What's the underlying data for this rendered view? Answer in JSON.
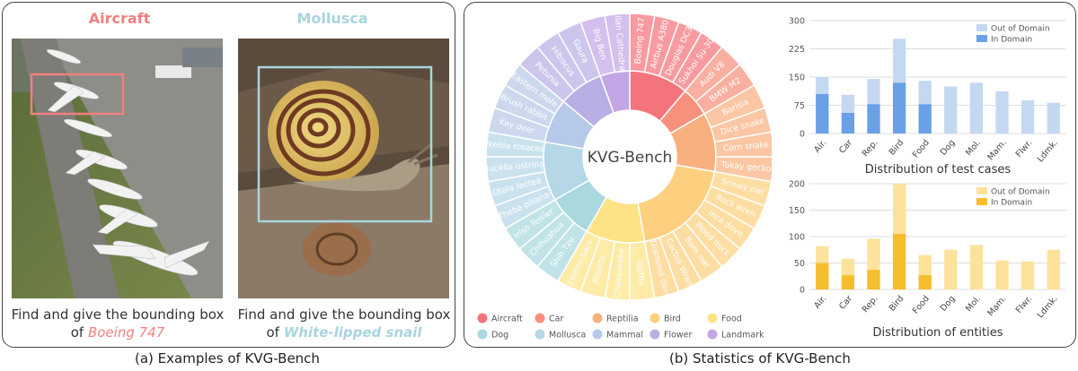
{
  "panel_a": {
    "caption": "(a) Examples of KVG-Bench",
    "examples": [
      {
        "category": "Aircraft",
        "color": "#f08080",
        "query_prefix": "Find and give the bounding box",
        "query_of": "of ",
        "target": "Boeing 747"
      },
      {
        "category": "Mollusca",
        "color": "#a9d4e0",
        "query_prefix": "Find and give the bounding box",
        "query_of": "of ",
        "target": "White-lipped snail"
      }
    ]
  },
  "panel_b": {
    "caption": "(b) Statistics of KVG-Bench",
    "sunburst": {
      "center_label": "KVG-Bench",
      "categories": [
        {
          "name": "Aircraft",
          "color": "#f4747c",
          "entities": [
            "Boeing 747",
            "Airbus A380",
            "Douglas DC3",
            "Sukhoi Su-30"
          ]
        },
        {
          "name": "Car",
          "color": "#f7917c",
          "entities": [
            "Audi V8",
            "BMW M2"
          ]
        },
        {
          "name": "Reptilia",
          "color": "#f9b07f",
          "entities": [
            "Barisia",
            "Dice snake",
            "Corn snake",
            "Tokay gecko"
          ]
        },
        {
          "name": "Bird",
          "color": "#fcd07e",
          "entities": [
            "Snowy owl",
            "Rock wren",
            "Inca dove",
            "Wood duck",
            "Barn owl",
            "Cactus Wren",
            "Diamond dove"
          ]
        },
        {
          "name": "Food",
          "color": "#fde385",
          "entities": [
            "Waffle",
            "Cheesecake",
            "Risotto",
            "Lemon bars"
          ]
        },
        {
          "name": "Dog",
          "color": "#a9d8de",
          "entities": [
            "Shih Tzu",
            "Chihuahua",
            "Irish Terrier"
          ]
        },
        {
          "name": "Mollusca",
          "color": "#b5d7e6",
          "entities": [
            "Theba pisana",
            "Otala lactea",
            "Nucella ostrina",
            "Okenia rosacea"
          ]
        },
        {
          "name": "Mammal",
          "color": "#b7c9e8",
          "entities": [
            "Key deer",
            "Brush rabbit",
            "Eastern mole"
          ]
        },
        {
          "name": "Flower",
          "color": "#b8b0e4",
          "entities": [
            "Petunia",
            "Hibiscus",
            "Gaura"
          ]
        },
        {
          "name": "Landmark",
          "color": "#c3a6e6",
          "entities": [
            "Big Ben",
            "Milan Cathedral"
          ]
        }
      ]
    }
  },
  "chart_data": [
    {
      "type": "bar",
      "title": "Distribution of test cases",
      "categories": [
        "Air.",
        "Car",
        "Rep.",
        "Bird",
        "Food",
        "Dog",
        "Mol.",
        "Mam.",
        "Flwr.",
        "Ldmk."
      ],
      "ylim": [
        0,
        300
      ],
      "yticks": [
        0,
        75,
        150,
        225,
        300
      ],
      "stacked": true,
      "grid": true,
      "legend_position": "top-right",
      "series": [
        {
          "name": "In Domain",
          "color": "#6aa0e6",
          "values": [
            105,
            55,
            78,
            135,
            78,
            0,
            0,
            0,
            0,
            0
          ]
        },
        {
          "name": "Out of Domain",
          "color": "#c5d8f2",
          "values": [
            45,
            48,
            67,
            117,
            62,
            125,
            135,
            112,
            88,
            82
          ]
        }
      ]
    },
    {
      "type": "bar",
      "title": "Distribution of entities",
      "categories": [
        "Air.",
        "Car",
        "Rep.",
        "Bird",
        "Food",
        "Dog",
        "Mol.",
        "Mam.",
        "Flwr.",
        "Ldmk."
      ],
      "ylim": [
        0,
        200
      ],
      "yticks": [
        0,
        50,
        100,
        150,
        200
      ],
      "stacked": true,
      "grid": true,
      "legend_position": "top-right",
      "series": [
        {
          "name": "In Domain",
          "color": "#f6bd2c",
          "values": [
            50,
            27,
            37,
            105,
            27,
            0,
            0,
            0,
            0,
            0
          ]
        },
        {
          "name": "Out of Domain",
          "color": "#fce29a",
          "values": [
            32,
            31,
            59,
            95,
            38,
            75,
            84,
            55,
            53,
            75
          ]
        }
      ]
    }
  ]
}
